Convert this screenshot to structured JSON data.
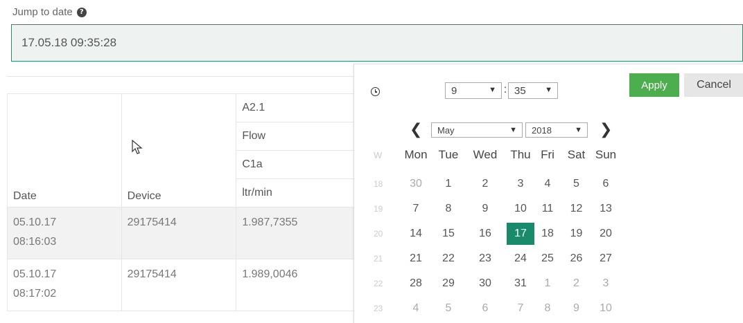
{
  "jump": {
    "label": "Jump to date",
    "help_icon": "question-circle-icon",
    "value": "17.05.18 09:35:28"
  },
  "table": {
    "header_stack": [
      "A2.1",
      "Flow",
      "C1a"
    ],
    "columns": [
      "Date",
      "Device",
      "ltr/min"
    ],
    "rows": [
      {
        "date_line1": "05.10.17",
        "date_line2": "08:16:03",
        "device": "29175414",
        "value": "1.987,7355"
      },
      {
        "date_line1": "05.10.17",
        "date_line2": "08:17:02",
        "device": "29175414",
        "value": "1.989,0046"
      }
    ]
  },
  "picker": {
    "clock_icon": "clock-icon",
    "hour": "9",
    "minute": "35",
    "time_separator": ":",
    "apply_label": "Apply",
    "cancel_label": "Cancel",
    "prev_icon": "chevron-left-icon",
    "next_icon": "chevron-right-icon",
    "prev_glyph": "❮",
    "next_glyph": "❯",
    "month": "May",
    "year": "2018",
    "week_header": "W",
    "weekdays": [
      "Mon",
      "Tue",
      "Wed",
      "Thu",
      "Fri",
      "Sat",
      "Sun"
    ],
    "weeks": [
      {
        "wk": "18",
        "days": [
          "30",
          "1",
          "2",
          "3",
          "4",
          "5",
          "6"
        ]
      },
      {
        "wk": "19",
        "days": [
          "7",
          "8",
          "9",
          "10",
          "11",
          "12",
          "13"
        ]
      },
      {
        "wk": "20",
        "days": [
          "14",
          "15",
          "16",
          "17",
          "18",
          "19",
          "20"
        ]
      },
      {
        "wk": "21",
        "days": [
          "21",
          "22",
          "23",
          "24",
          "25",
          "26",
          "27"
        ]
      },
      {
        "wk": "22",
        "days": [
          "28",
          "29",
          "30",
          "31",
          "1",
          "2",
          "3"
        ]
      },
      {
        "wk": "23",
        "days": [
          "4",
          "5",
          "6",
          "7",
          "8",
          "9",
          "10"
        ]
      }
    ],
    "selected_day": "17",
    "colors": {
      "selected": "#1a8a6c",
      "apply": "#4cae4c"
    }
  }
}
